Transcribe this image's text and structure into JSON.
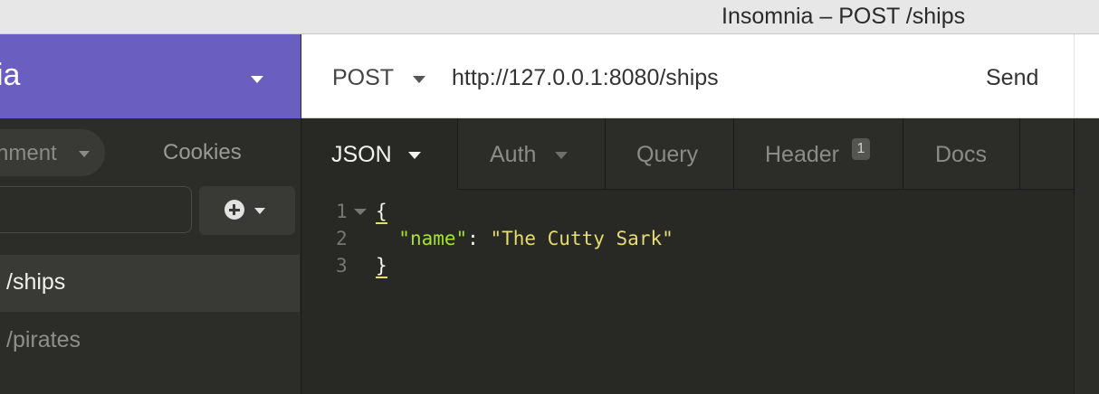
{
  "window": {
    "title": "Insomnia – POST /ships"
  },
  "workspace": {
    "name": "ia"
  },
  "request": {
    "method": "POST",
    "url": "http://127.0.0.1:8080/ships",
    "send_label": "Send"
  },
  "sidebar": {
    "environment_label": "nment",
    "cookies_label": "Cookies",
    "filter_placeholder": "",
    "items": [
      {
        "label": "/ships",
        "active": true
      },
      {
        "label": "/pirates",
        "active": false
      }
    ]
  },
  "tabs": [
    {
      "label": "JSON",
      "active": true,
      "has_dropdown": true
    },
    {
      "label": "Auth",
      "active": false,
      "has_dropdown": true
    },
    {
      "label": "Query",
      "active": false
    },
    {
      "label": "Header",
      "active": false,
      "badge": "1"
    },
    {
      "label": "Docs",
      "active": false
    }
  ],
  "editor": {
    "lines": [
      {
        "num": "1",
        "open": "{"
      },
      {
        "num": "2",
        "key": "\"name\"",
        "colon": ": ",
        "value": "\"The Cutty Sark\""
      },
      {
        "num": "3",
        "close": "}"
      }
    ]
  },
  "colors": {
    "accent": "#6b5ec1",
    "json_key": "#a6e22e",
    "json_string": "#e6db74"
  }
}
